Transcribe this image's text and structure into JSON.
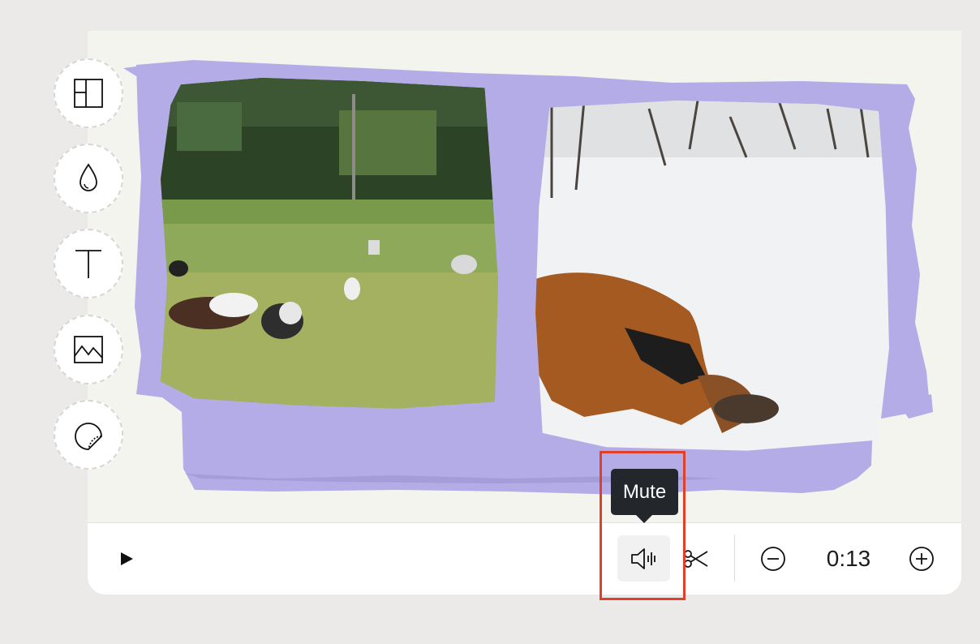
{
  "editor": {
    "tools": [
      {
        "name": "layout",
        "icon": "layout-icon"
      },
      {
        "name": "color",
        "icon": "droplet-icon"
      },
      {
        "name": "text",
        "icon": "text-icon"
      },
      {
        "name": "media",
        "icon": "image-icon"
      },
      {
        "name": "sticker",
        "icon": "sticker-icon"
      }
    ],
    "background_shape_color": "#b3ace6",
    "canvas_color": "#f4f4ee",
    "clips": [
      {
        "description_icon": "video-clip-dogs-park"
      },
      {
        "description_icon": "video-clip-dog-snow"
      }
    ]
  },
  "controls": {
    "play_icon": "play-icon",
    "mute_icon": "speaker-icon",
    "scissors_icon": "scissors-icon",
    "zoom_out_icon": "minus-circle-icon",
    "zoom_in_icon": "plus-circle-icon",
    "time": "0:13"
  },
  "tooltip": {
    "label": "Mute"
  },
  "highlight_color": "#e0402a"
}
